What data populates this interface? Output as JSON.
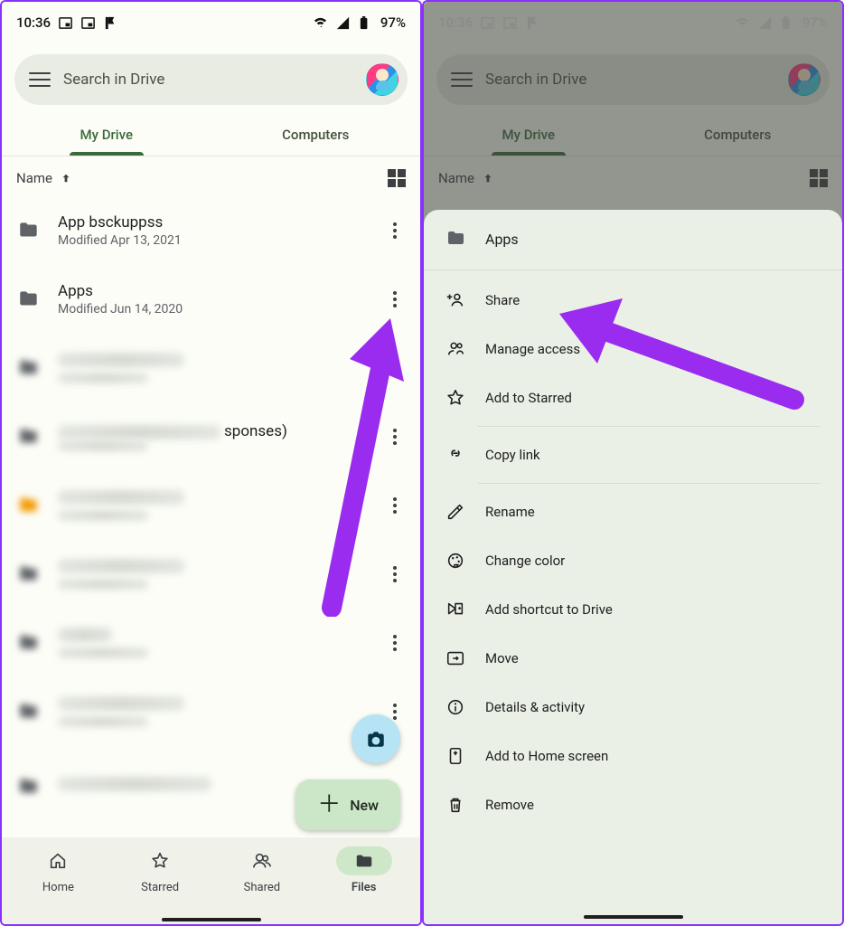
{
  "status": {
    "time": "10:36",
    "battery": "97%"
  },
  "search": {
    "placeholder": "Search in Drive"
  },
  "tabs": {
    "my_drive": "My Drive",
    "computers": "Computers"
  },
  "sort": {
    "label": "Name"
  },
  "files": [
    {
      "name": "App bsckuppss",
      "sub": "Modified Apr 13, 2021"
    },
    {
      "name": "Apps",
      "sub": "Modified Jun 14, 2020"
    }
  ],
  "blurred_tail": "sponses)",
  "fab": {
    "new_label": "New"
  },
  "nav": {
    "home": "Home",
    "starred": "Starred",
    "shared": "Shared",
    "files": "Files"
  },
  "sheet": {
    "title": "Apps",
    "share": "Share",
    "manage_access": "Manage access",
    "add_starred": "Add to Starred",
    "copy_link": "Copy link",
    "rename": "Rename",
    "change_color": "Change color",
    "add_shortcut": "Add shortcut to Drive",
    "move": "Move",
    "details": "Details & activity",
    "add_home": "Add to Home screen",
    "remove": "Remove"
  }
}
